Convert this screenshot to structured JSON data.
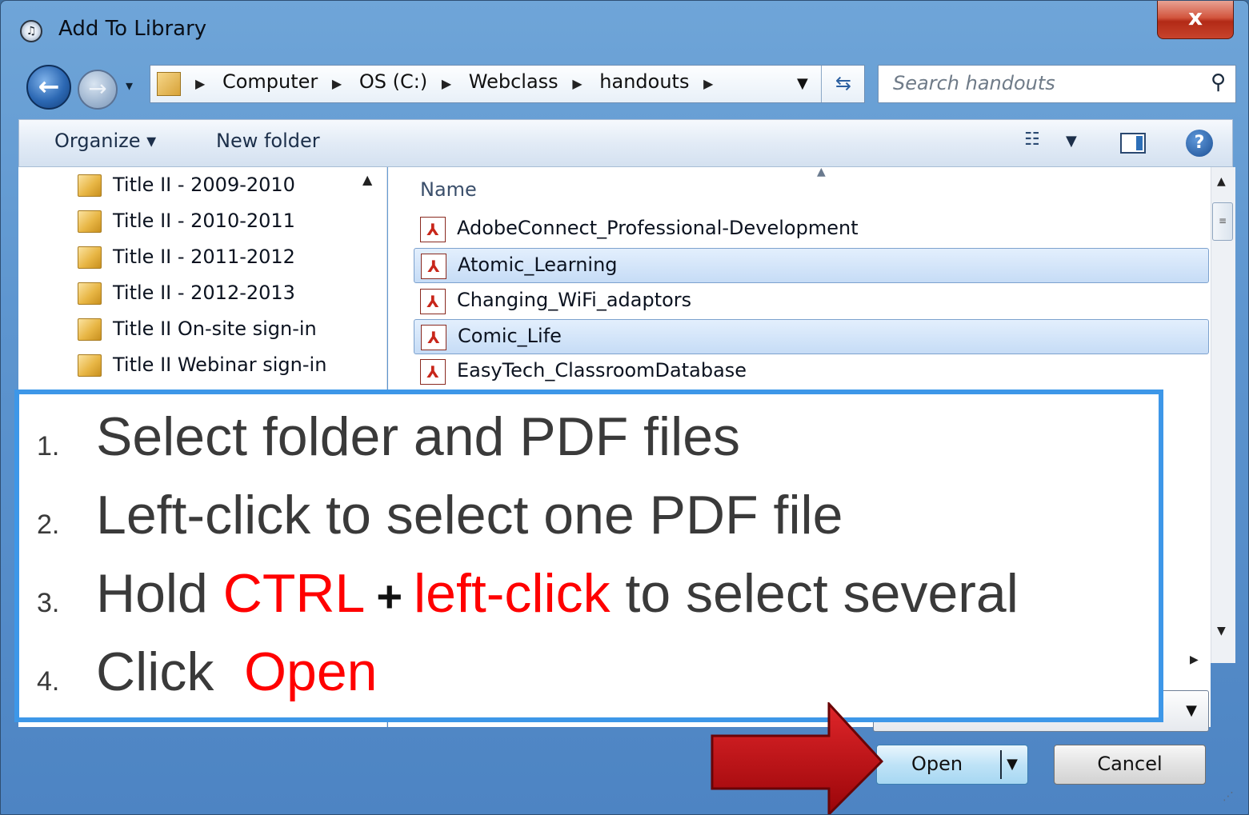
{
  "window": {
    "title": "Add To Library",
    "close_label": "x"
  },
  "nav": {
    "breadcrumbs": [
      "Computer",
      "OS (C:)",
      "Webclass",
      "handouts"
    ],
    "search_placeholder": "Search handouts"
  },
  "toolbar": {
    "organize": "Organize ▾",
    "new_folder": "New folder",
    "help": "?"
  },
  "tree": {
    "items": [
      "Title II - 2009-2010",
      "Title II - 2010-2011",
      "Title II - 2011-2012",
      "Title II - 2012-2013",
      "Title II On-site sign-in",
      "Title II Webinar sign-in"
    ]
  },
  "files": {
    "column_header": "Name",
    "items": [
      {
        "name": "AdobeConnect_Professional-Development",
        "selected": false
      },
      {
        "name": "Atomic_Learning",
        "selected": true
      },
      {
        "name": "Changing_WiFi_adaptors",
        "selected": false
      },
      {
        "name": "Comic_Life",
        "selected": true
      },
      {
        "name": "EasyTech_ClassroomDatabase",
        "selected": false
      }
    ]
  },
  "buttons": {
    "open": "Open",
    "cancel": "Cancel"
  },
  "instructions": {
    "step1_num": "1.",
    "step1_text": "Select folder and PDF files",
    "step2_num": "2.",
    "step2_text": "Left-click to select one PDF file",
    "step3_num": "3.",
    "step3_pre": "Hold ",
    "step3_ctrl": "CTRL",
    "step3_plus": "+",
    "step3_click": "left-click",
    "step3_post": " to select several",
    "step4_num": "4.",
    "step4_pre": "Click  ",
    "step4_open": "Open"
  },
  "colors": {
    "accent_red": "#ff0000",
    "callout_border": "#3d97e8",
    "arrow": "#c0090b"
  }
}
